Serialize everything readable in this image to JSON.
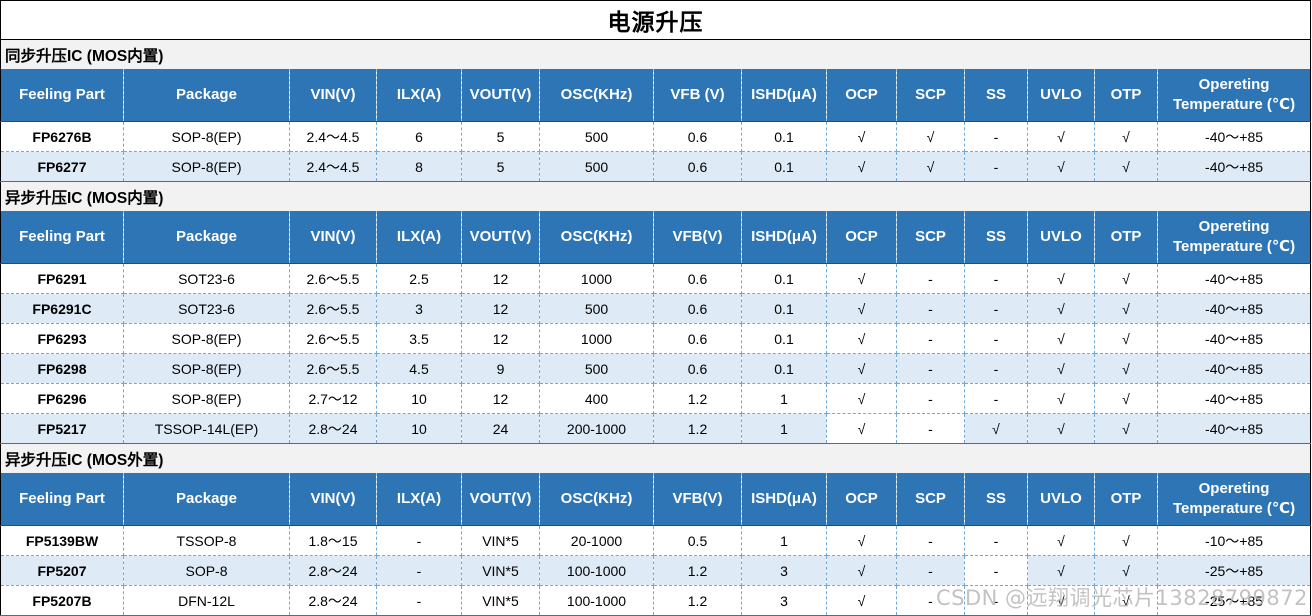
{
  "title": "电源升压",
  "columns": [
    "Feeling Part",
    "Package",
    "VIN(V)",
    "ILX(A)",
    "VOUT(V)",
    "OSC(KHz)",
    "VFB (V)",
    "ISHD(μA)",
    "OCP",
    "SCP",
    "SS",
    "UVLO",
    "OTP",
    "Opereting Temperature (℃)"
  ],
  "columns_b": [
    "Feeling Part",
    "Package",
    "VIN(V)",
    "ILX(A)",
    "VOUT(V)",
    "OSC(KHz)",
    "VFB(V)",
    "ISHD(μA)",
    "OCP",
    "SCP",
    "SS",
    "UVLO",
    "OTP",
    "Opereting Temperature (℃)"
  ],
  "sections": [
    {
      "title": "同步升压IC (MOS内置)",
      "rows": [
        [
          "FP6276B",
          "SOP-8(EP)",
          "2.4～4.5",
          "6",
          "5",
          "500",
          "0.6",
          "0.1",
          "√",
          "√",
          "-",
          "√",
          "√",
          "-40～+85"
        ],
        [
          "FP6277",
          "SOP-8(EP)",
          "2.4～4.5",
          "8",
          "5",
          "500",
          "0.6",
          "0.1",
          "√",
          "√",
          "-",
          "√",
          "√",
          "-40～+85"
        ]
      ]
    },
    {
      "title": "异步升压IC (MOS内置)",
      "rows": [
        [
          "FP6291",
          "SOT23-6",
          "2.6～5.5",
          "2.5",
          "12",
          "1000",
          "0.6",
          "0.1",
          "√",
          "-",
          "-",
          "√",
          "√",
          "-40～+85"
        ],
        [
          "FP6291C",
          "SOT23-6",
          "2.6～5.5",
          "3",
          "12",
          "500",
          "0.6",
          "0.1",
          "√",
          "-",
          "-",
          "√",
          "√",
          "-40～+85"
        ],
        [
          "FP6293",
          "SOP-8(EP)",
          "2.6～5.5",
          "3.5",
          "12",
          "1000",
          "0.6",
          "0.1",
          "√",
          "-",
          "-",
          "√",
          "√",
          "-40～+85"
        ],
        [
          "FP6298",
          "SOP-8(EP)",
          "2.6～5.5",
          "4.5",
          "9",
          "500",
          "0.6",
          "0.1",
          "√",
          "-",
          "-",
          "√",
          "√",
          "-40～+85"
        ],
        [
          "FP6296",
          "SOP-8(EP)",
          "2.7～12",
          "10",
          "12",
          "400",
          "1.2",
          "1",
          "√",
          "-",
          "-",
          "√",
          "√",
          "-40～+85"
        ],
        [
          "FP5217",
          "TSSOP-14L(EP)",
          "2.8～24",
          "10",
          "24",
          "200-1000",
          "1.2",
          "1",
          "√",
          "-",
          "√",
          "√",
          "√",
          "-40～+85"
        ]
      ]
    },
    {
      "title": "异步升压IC (MOS外置)",
      "rows": [
        [
          "FP5139BW",
          "TSSOP-8",
          "1.8～15",
          "-",
          "VIN*5",
          "20-1000",
          "0.5",
          "1",
          "√",
          "-",
          "-",
          "√",
          "√",
          "-10～+85"
        ],
        [
          "FP5207",
          "SOP-8",
          "2.8～24",
          "-",
          "VIN*5",
          "100-1000",
          "1.2",
          "3",
          "√",
          "-",
          "-",
          "√",
          "√",
          "-25～+85"
        ],
        [
          "FP5207B",
          "DFN-12L",
          "2.8～24",
          "-",
          "VIN*5",
          "100-1000",
          "1.2",
          "3",
          "√",
          "-",
          "-",
          "√",
          "√",
          "-25～+85"
        ]
      ]
    }
  ],
  "watermark": "CSDN @远翔调光芯片13828799872"
}
